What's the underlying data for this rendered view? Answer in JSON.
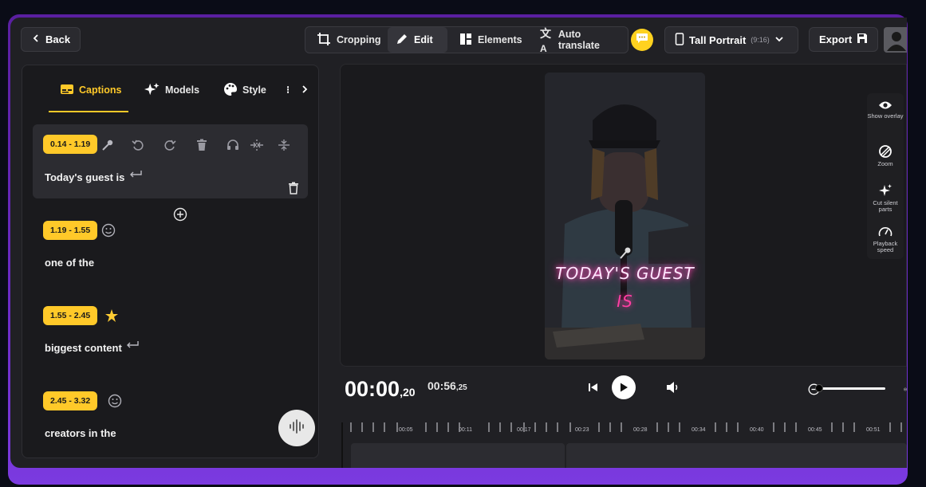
{
  "topbar": {
    "back_label": "Back",
    "tabs": [
      {
        "label": "Cropping",
        "icon": "crop-icon",
        "active": false
      },
      {
        "label": "Edit",
        "icon": "pencil-icon",
        "active": true
      },
      {
        "label": "Elements",
        "icon": "elements-icon",
        "active": false
      },
      {
        "label": "Auto translate",
        "icon": "translate-icon",
        "active": false
      }
    ],
    "format_label": "Tall Portrait",
    "format_ratio": "(9:16)",
    "export_label": "Export"
  },
  "panel": {
    "tabs": [
      {
        "label": "Captions",
        "active": true
      },
      {
        "label": "Models",
        "active": false
      },
      {
        "label": "Style",
        "active": false
      }
    ],
    "captions": [
      {
        "time": "0.14 - 1.19",
        "text": "Today's guest is",
        "selected": true
      },
      {
        "time": "1.19 - 1.55",
        "text": "one of the",
        "emoji": "smiley-icon"
      },
      {
        "time": "1.55 - 2.45",
        "text": "biggest content",
        "emoji": "star-icon"
      },
      {
        "time": "2.45 - 3.32",
        "text": "creators in the",
        "emoji": "smiley-icon"
      }
    ]
  },
  "preview": {
    "caption_line1": "TODAY'S GUEST",
    "caption_line2": "IS",
    "side_tools": [
      {
        "label": "Show overlay",
        "icon": "eye-icon"
      },
      {
        "label": "Zoom",
        "icon": "zoom-icon"
      },
      {
        "label": "Cut silent parts",
        "icon": "sparkle-icon"
      },
      {
        "label": "Playback speed",
        "icon": "speedometer-icon"
      }
    ]
  },
  "timeline": {
    "current_main": "00:00",
    "current_frac": ",20",
    "duration_main": "00:56",
    "duration_frac": ",25",
    "ticks": [
      "00:05",
      "00:11",
      "00:17",
      "00:23",
      "00:28",
      "00:34",
      "00:40",
      "00:45",
      "00:51"
    ]
  },
  "colors": {
    "accent": "#ffc929",
    "brand_purple": "#6b2bc6",
    "caption_pink": "#ff3fa3"
  }
}
